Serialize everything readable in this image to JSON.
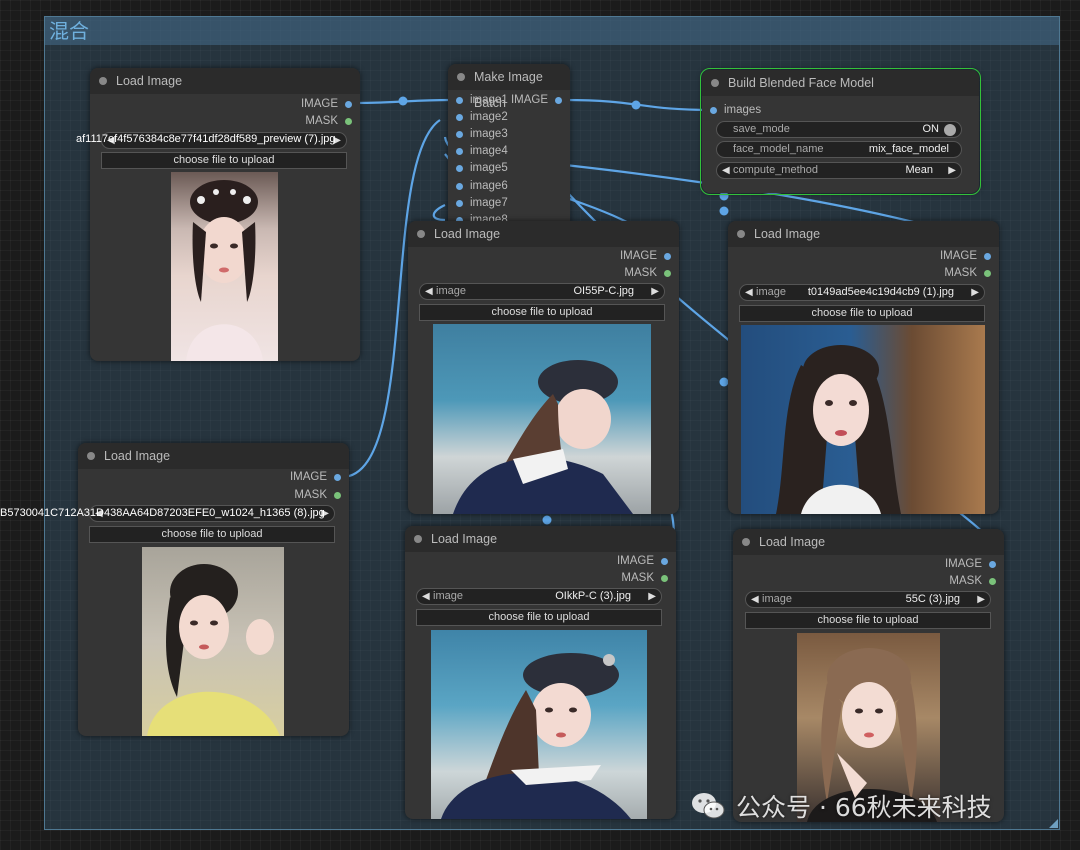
{
  "group": {
    "title": "混合"
  },
  "colors": {
    "image_socket": "#6aa8e0",
    "mask_socket": "#7ac27a",
    "link": "#5ea5e6",
    "selected": "#33c13a"
  },
  "nodes": {
    "load1": {
      "title": "Load Image",
      "outputs": [
        "IMAGE",
        "MASK"
      ],
      "image_value": "af1117ef4f576384c8e77f41df28df589_preview (7).jpg",
      "upload_label": "choose file to upload"
    },
    "make_batch": {
      "title": "Make Image Batch",
      "inputs": [
        "image1",
        "image2",
        "image3",
        "image4",
        "image5",
        "image6",
        "image7",
        "image8"
      ],
      "output": "IMAGE"
    },
    "blend": {
      "title": "Build Blended Face Model",
      "input": "images",
      "save_mode_label": "save_mode",
      "save_mode_value": "ON",
      "face_model_name_label": "face_model_name",
      "face_model_name_value": "mix_face_model",
      "compute_method_label": "compute_method",
      "compute_method_value": "Mean"
    },
    "load2": {
      "title": "Load Image",
      "outputs": [
        "IMAGE",
        "MASK"
      ],
      "image_label": "image",
      "image_value": "OI55P-C.jpg",
      "upload_label": "choose file to upload"
    },
    "load3": {
      "title": "Load Image",
      "outputs": [
        "IMAGE",
        "MASK"
      ],
      "image_label": "image",
      "image_value": "t0149ad5ee4c19d4cb9 (1).jpg",
      "upload_label": "choose file to upload"
    },
    "load4": {
      "title": "Load Image",
      "outputs": [
        "IMAGE",
        "MASK"
      ],
      "image_value": "B5730041C712A31D438AA64D87203EFE0_w1024_h1365 (8).jpg",
      "upload_label": "choose file to upload"
    },
    "load5": {
      "title": "Load Image",
      "outputs": [
        "IMAGE",
        "MASK"
      ],
      "image_label": "image",
      "image_value": "OIkkP-C (3).jpg",
      "upload_label": "choose file to upload"
    },
    "load6": {
      "title": "Load Image",
      "outputs": [
        "IMAGE",
        "MASK"
      ],
      "image_label": "image",
      "image_value": "55C (3).jpg",
      "upload_label": "choose file to upload"
    }
  },
  "watermark": {
    "text": "公众号 · 66秋未来科技",
    "icon": "wechat-icon"
  }
}
